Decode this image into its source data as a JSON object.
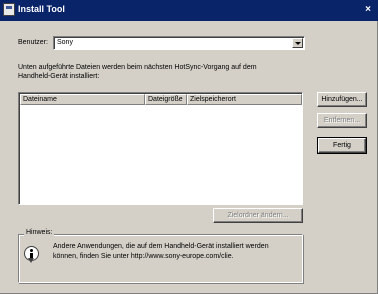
{
  "window": {
    "title": "Install Tool",
    "close_glyph": "×"
  },
  "user": {
    "label": "Benutzer:",
    "selected": "Sony"
  },
  "instructions": {
    "line1": "Unten aufgeführte Dateien werden beim nächsten HotSync-Vorgang auf dem",
    "line2": "Handheld-Gerät installiert:"
  },
  "table": {
    "columns": [
      "Dateiname",
      "Dateigröße",
      "Zielspeicherort"
    ],
    "rows": []
  },
  "buttons": {
    "add": "Hinzufügen...",
    "remove": "Entfernen...",
    "done": "Fertig",
    "change_folder": "Zielordner ändern..."
  },
  "hint": {
    "title": "Hinweis:",
    "line1": "Andere Anwendungen, die auf dem Handheld-Gerät installiert werden",
    "line2": "können, finden Sie unter http://www.sony-europe.com/clie."
  },
  "icons": {
    "title": "app-icon",
    "combo": "chevron-down-icon",
    "hint": "info-icon"
  }
}
